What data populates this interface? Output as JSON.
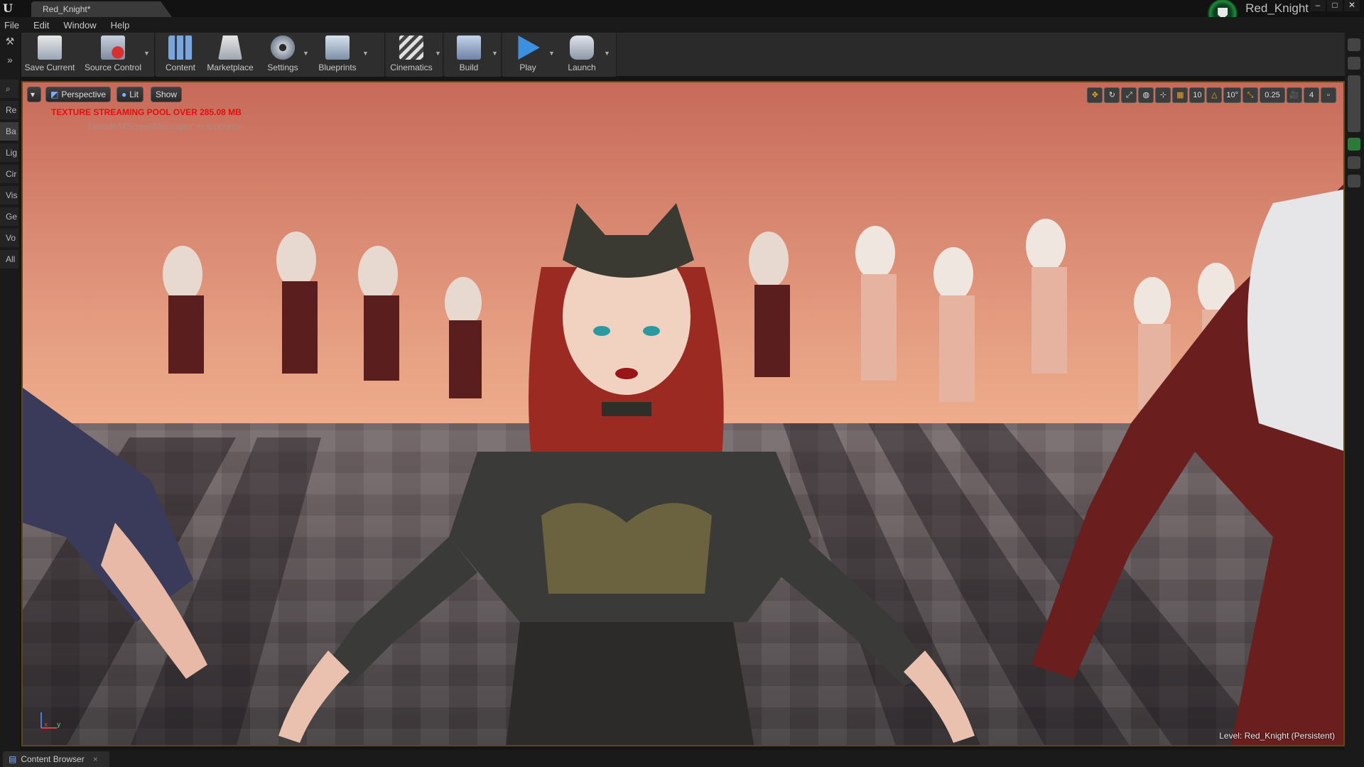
{
  "window": {
    "tab_title": "Red_Knight*",
    "project_name": "Red_Knight",
    "min": "–",
    "max": "□",
    "close": "✕"
  },
  "menu": [
    "File",
    "Edit",
    "Window",
    "Help"
  ],
  "toolbar": {
    "save": "Save Current",
    "source": "Source Control",
    "content": "Content",
    "marketplace": "Marketplace",
    "settings": "Settings",
    "blueprints": "Blueprints",
    "cinematics": "Cinematics",
    "build": "Build",
    "play": "Play",
    "launch": "Launch"
  },
  "side_tabs": [
    "Re",
    "Ba",
    "Lig",
    "Cir",
    "Vis",
    "Ge",
    "Vo",
    "All"
  ],
  "viewport": {
    "perspective": "Perspective",
    "lit": "Lit",
    "show": "Show",
    "grid_snap": "10",
    "rot_snap": "10°",
    "scale_snap": "0.25",
    "cam_speed": "4",
    "warning": "TEXTURE STREAMING POOL OVER 285.08 MB",
    "suppress": "'DisableAllScreenMessages' to suppress",
    "level_label": "Level:",
    "level_name": "Red_Knight (Persistent)",
    "axis_x": "x",
    "axis_y": "y"
  },
  "bottom": {
    "content_browser": "Content Browser"
  },
  "colors": {
    "accent_green": "#1f8a3b",
    "warning_red": "#e01010",
    "snap_orange": "#f0a020"
  }
}
